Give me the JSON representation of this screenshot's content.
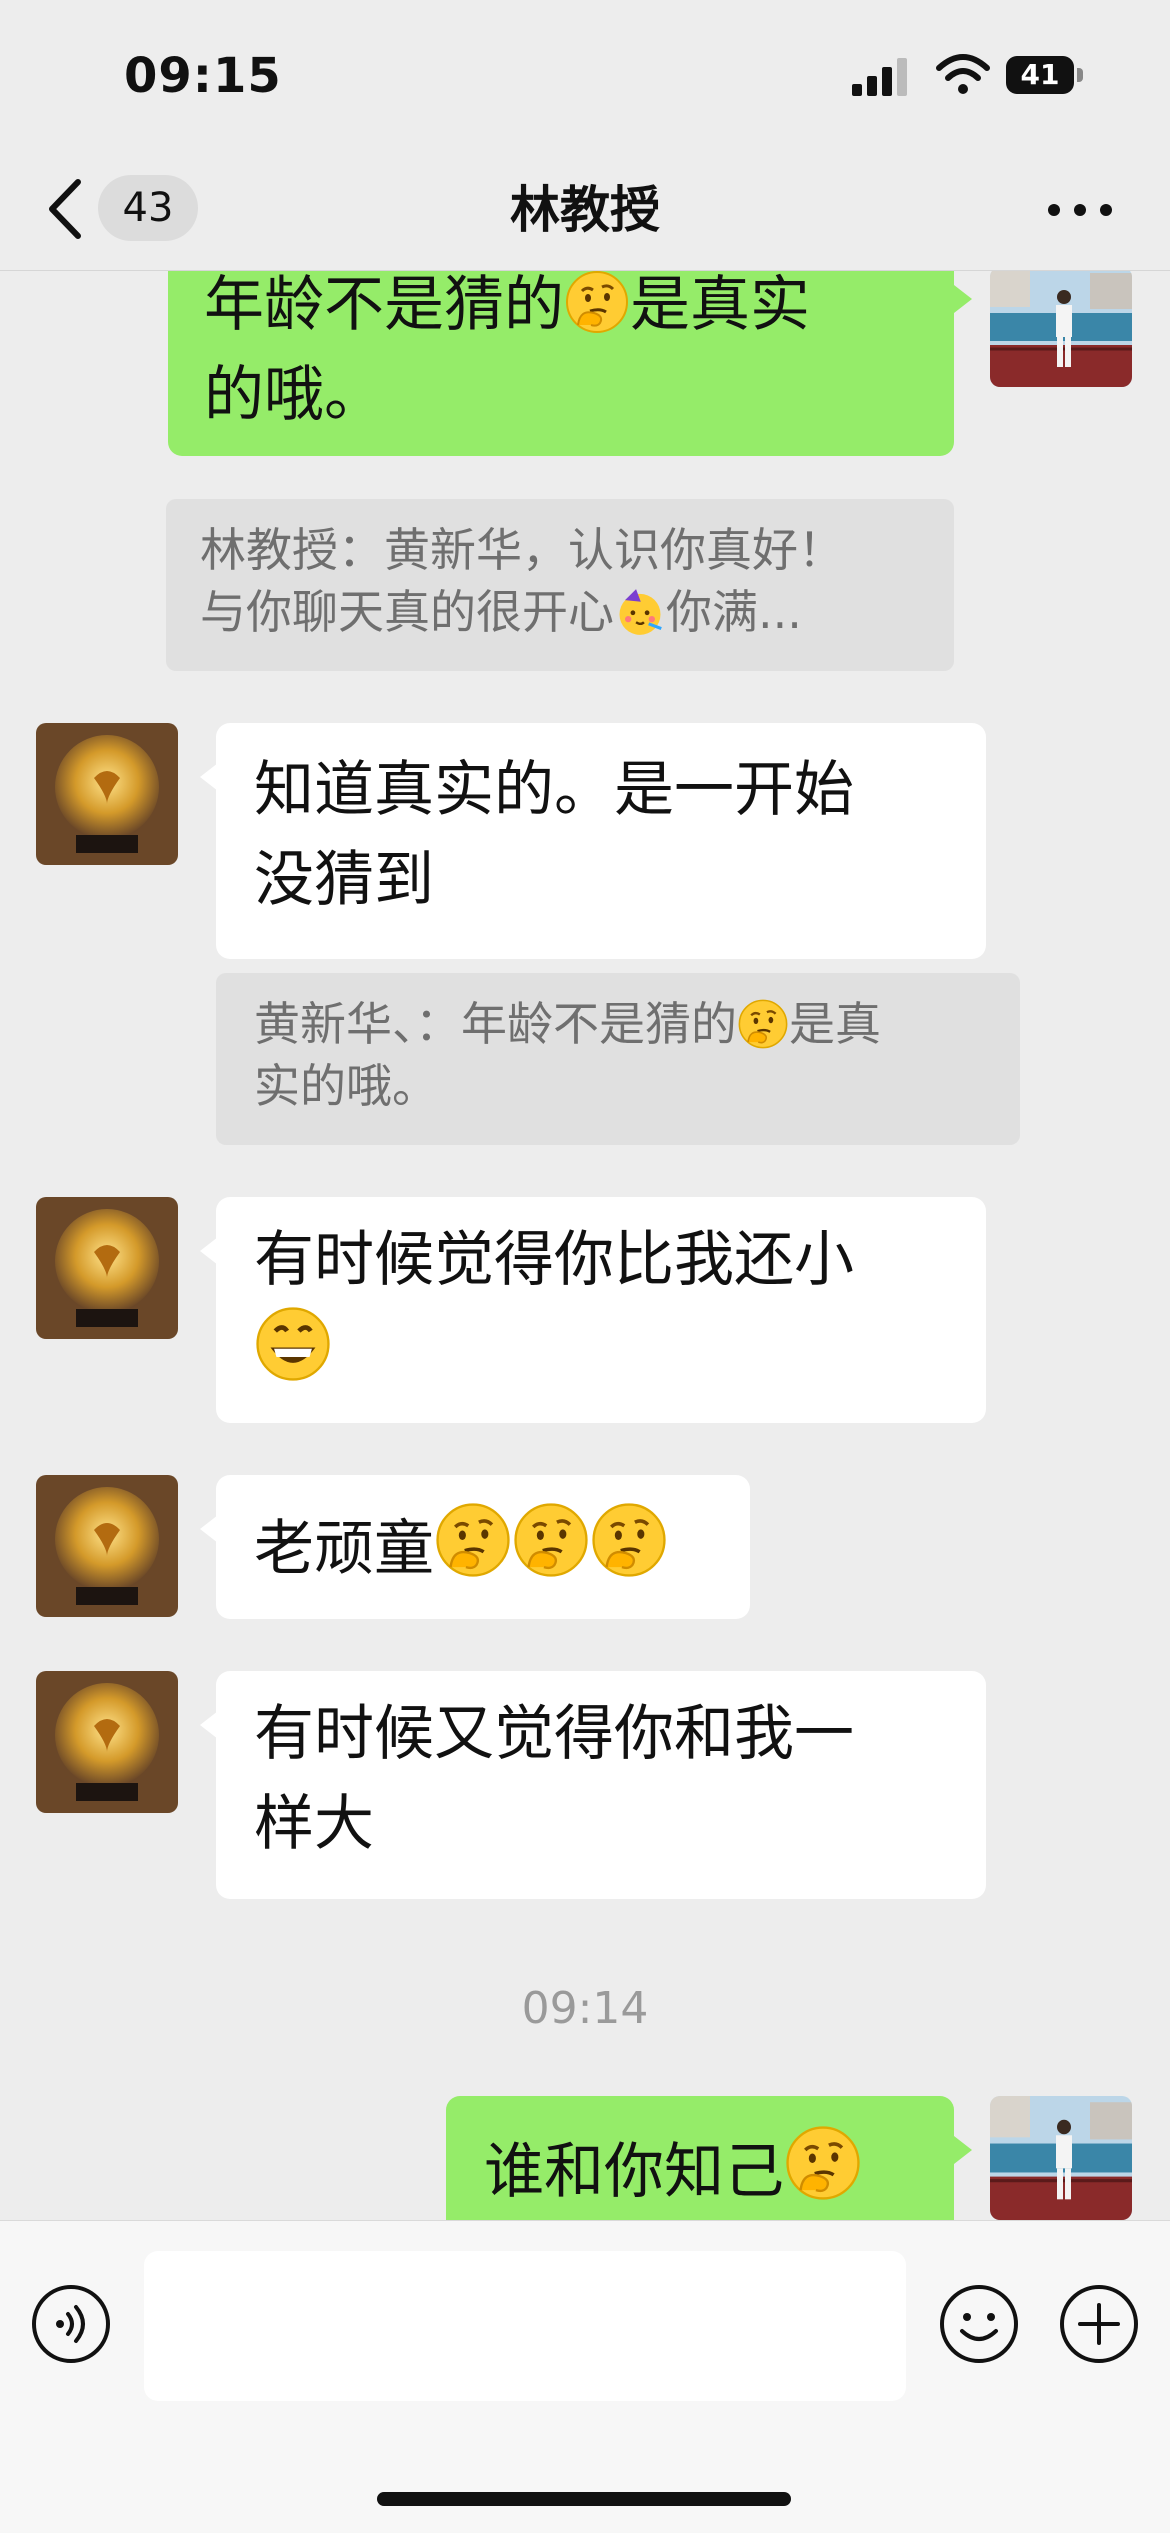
{
  "status_bar": {
    "time": "09:15",
    "battery": "41"
  },
  "nav": {
    "badge": "43",
    "title": "林教授"
  },
  "messages": [
    {
      "from": "me",
      "text_a": "年龄不是猜的",
      "text_b": "是真实",
      "text_c": "的哦。",
      "quote_line1": "林教授：黄新华，认识你真好！",
      "quote_line2_a": "与你聊天真的很开心",
      "quote_line2_b": "你满..."
    },
    {
      "from": "other",
      "line1": "知道真实的。是一开始",
      "line2": "没猜到",
      "quote_line1_a": "黄新华、：年龄不是猜的",
      "quote_line1_b": "是真",
      "quote_line2": "实的哦。"
    },
    {
      "from": "other",
      "line1": "有时候觉得你比我还小"
    },
    {
      "from": "other",
      "line1": "老顽童"
    },
    {
      "from": "other",
      "line1": "有时候又觉得你和我一",
      "line2": "样大"
    },
    {
      "from": "me",
      "line1": "谁和你知己"
    }
  ],
  "timestamp": "09:14",
  "icons": {
    "thinking": "thinking-face-emoji",
    "party": "partying-face-emoji",
    "grin": "grinning-face-emoji",
    "voice": "voice-icon",
    "emoji_button": "smiley-icon",
    "plus": "plus-icon",
    "back": "chevron-left-icon",
    "more": "more-icon"
  },
  "colors": {
    "my_bubble": "#95ec69",
    "their_bubble": "#ffffff",
    "background": "#ededed",
    "quote": "#e0e0e0"
  }
}
